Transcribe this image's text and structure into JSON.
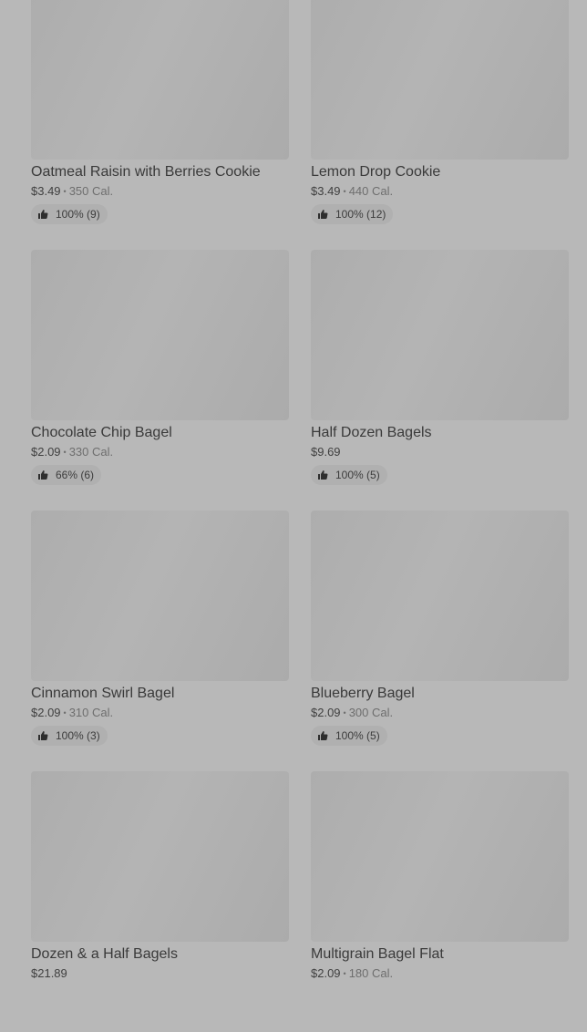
{
  "items": [
    {
      "name": "Oatmeal Raisin with Berries Cookie",
      "price": "$3.49",
      "calories": "350 Cal.",
      "rating": "100% (9)"
    },
    {
      "name": "Lemon Drop Cookie",
      "price": "$3.49",
      "calories": "440 Cal.",
      "rating": "100% (12)"
    },
    {
      "name": "Chocolate Chip Bagel",
      "price": "$2.09",
      "calories": "330 Cal.",
      "rating": "66% (6)"
    },
    {
      "name": "Half Dozen Bagels",
      "price": "$9.69",
      "calories": "",
      "rating": "100% (5)"
    },
    {
      "name": "Cinnamon Swirl Bagel",
      "price": "$2.09",
      "calories": "310 Cal.",
      "rating": "100% (3)"
    },
    {
      "name": "Blueberry Bagel",
      "price": "$2.09",
      "calories": "300 Cal.",
      "rating": "100% (5)"
    },
    {
      "name": "Dozen & a Half Bagels",
      "price": "$21.89",
      "calories": "",
      "rating": ""
    },
    {
      "name": "Multigrain Bagel Flat",
      "price": "$2.09",
      "calories": "180 Cal.",
      "rating": ""
    }
  ],
  "separator": "•",
  "icons": {
    "rating": "thumbs-up-icon"
  }
}
